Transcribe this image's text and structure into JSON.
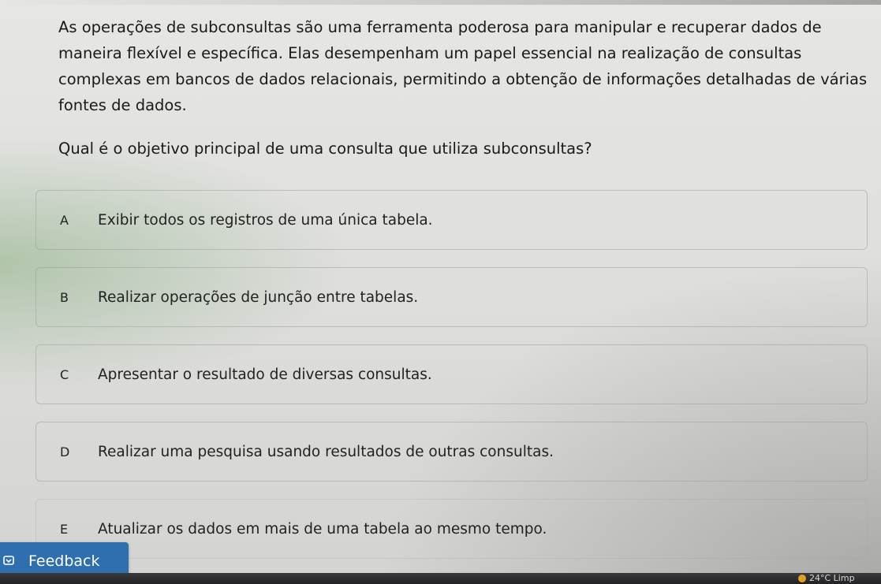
{
  "content": {
    "paragraph": "As operações de subconsultas são uma ferramenta poderosa para manipular e recuperar dados de maneira flexível e específica. Elas desempenham um papel essencial na realização de consultas complexas em bancos de dados relacionais, permitindo a obtenção de informações detalhadas de várias fontes de dados.",
    "question": "Qual é o objetivo principal de uma consulta que utiliza subconsultas?"
  },
  "options": [
    {
      "letter": "A",
      "text": "Exibir todos os registros de uma única tabela."
    },
    {
      "letter": "B",
      "text": "Realizar operações de junção entre tabelas."
    },
    {
      "letter": "C",
      "text": "Apresentar o resultado de diversas consultas."
    },
    {
      "letter": "D",
      "text": "Realizar uma pesquisa usando resultados de outras consultas."
    },
    {
      "letter": "E",
      "text": "Atualizar os dados em mais de uma tabela ao mesmo tempo."
    }
  ],
  "feedback": {
    "label": "Feedback",
    "icon": "feedback-icon"
  },
  "taskbar": {
    "weather": "24°C  Limp"
  },
  "colors": {
    "feedback_bg": "#2f6fb0",
    "text": "#1a1a1a"
  }
}
